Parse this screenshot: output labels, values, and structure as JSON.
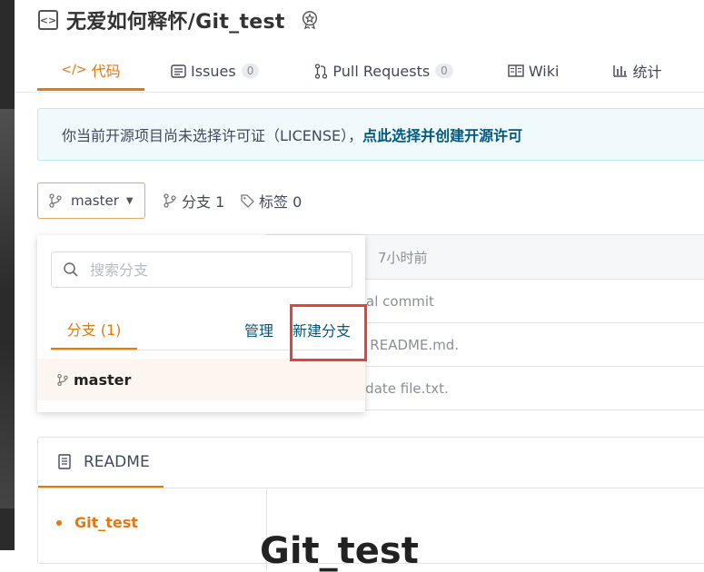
{
  "repo": {
    "title": "无爱如何释怀/Git_test"
  },
  "tabs": [
    {
      "label": "代码",
      "icon": "code-icon"
    },
    {
      "label": "Issues",
      "count": "0",
      "icon": "issues-icon"
    },
    {
      "label": "Pull Requests",
      "count": "0",
      "icon": "pull-request-icon"
    },
    {
      "label": "Wiki",
      "icon": "book-icon"
    },
    {
      "label": "统计",
      "icon": "stats-icon"
    }
  ],
  "license": {
    "text": "你当前开源项目尚未选择许可证（LICENSE），",
    "link": "点此选择并创建开源许可"
  },
  "branch": {
    "current": "master",
    "branches_label": "分支 1",
    "tags_label": "标签 0"
  },
  "dropdown": {
    "search_placeholder": "搜索分支",
    "tab_label": "分支 (1)",
    "manage_label": "管理",
    "new_branch_label": "新建分支",
    "items": [
      "master"
    ]
  },
  "files": {
    "header_time": "7小时前",
    "rows": [
      "tial commit",
      "d README.md.",
      "odate file.txt."
    ]
  },
  "readme": {
    "tab_label": "README",
    "toc": [
      "Git_test"
    ],
    "heading": "Git_test"
  },
  "colors": {
    "accent": "#e8760e",
    "link": "#005980",
    "highlight": "#e8403a"
  }
}
